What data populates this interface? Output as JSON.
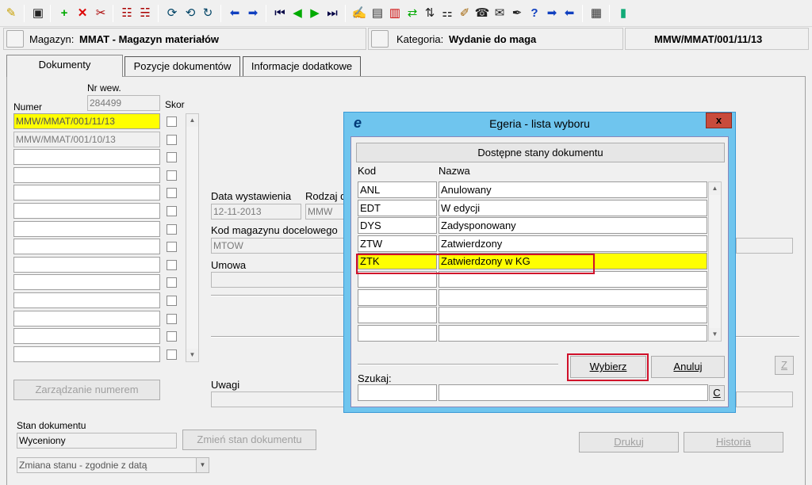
{
  "toolbar": {
    "icons": [
      "pin-icon",
      "save-icon",
      "add-icon",
      "delete-icon",
      "cut-icon",
      "split-icon",
      "split2-icon",
      "refresh-icon",
      "refresh2-icon",
      "refresh3-icon",
      "arrow-left-icon",
      "arrow-right-icon",
      "first-icon",
      "prev-icon",
      "next-icon",
      "last-icon",
      "edit-icon",
      "doc-icon",
      "doc-red-icon",
      "sync-icon",
      "sort-icon",
      "tree-icon",
      "brush-icon",
      "phone-icon",
      "mail-icon",
      "pen-icon",
      "help-icon",
      "forward-icon",
      "back-icon",
      "page-icon",
      "exit-icon"
    ]
  },
  "header": {
    "magazyn_label": "Magazyn:",
    "magazyn_value": "MMAT - Magazyn materiałów",
    "kategoria_label": "Kategoria:",
    "kategoria_value": "Wydanie do maga",
    "doc_number": "MMW/MMAT/001/11/13"
  },
  "tabs": [
    {
      "label": "Dokumenty"
    },
    {
      "label": "Pozycje dokumentów"
    },
    {
      "label": "Informacje dodatkowe"
    }
  ],
  "left": {
    "nr_wew_label": "Nr wew.",
    "nr_wew_value": "284499",
    "numer_label": "Numer",
    "skor_label": "Skor",
    "rows": [
      "MMW/MMAT/001/11/13",
      "MMW/MMAT/001/10/13",
      "",
      "",
      "",
      "",
      "",
      "",
      "",
      "",
      "",
      "",
      "",
      ""
    ]
  },
  "mid": {
    "data_wyst_label": "Data wystawienia",
    "data_wyst_value": "12-11-2013",
    "rodzaj_label": "Rodzaj d",
    "rodzaj_value": "MMW",
    "kod_mag_label": "Kod magazynu docelowego",
    "kod_mag_value": "MTOW",
    "umowa_label": "Umowa",
    "umowa_value": "",
    "uwagi_label": "Uwagi",
    "uwagi_value": ""
  },
  "buttons": {
    "zarzadzanie": "Zarządzanie numerem",
    "zmien_stan": "Zmień stan dokumentu",
    "drukuj": "Drukuj",
    "historia": "Historia",
    "z_btn": "Z"
  },
  "bottom": {
    "stan_label": "Stan dokumentu",
    "stan_value": "Wyceniony",
    "zmiana_value": "Zmiana stanu - zgodnie z datą"
  },
  "dialog": {
    "title": "Egeria - lista wyboru",
    "logo": "e",
    "close": "x",
    "header_button": "Dostępne stany dokumentu",
    "col_kod": "Kod",
    "col_nazwa": "Nazwa",
    "rows": [
      {
        "kod": "ANL",
        "nazwa": "Anulowany"
      },
      {
        "kod": "EDT",
        "nazwa": "W edycji"
      },
      {
        "kod": "DYS",
        "nazwa": "Zadysponowany"
      },
      {
        "kod": "ZTW",
        "nazwa": "Zatwierdzony"
      },
      {
        "kod": "ZTK",
        "nazwa": "Zatwierdzony w KG"
      },
      {
        "kod": "",
        "nazwa": ""
      },
      {
        "kod": "",
        "nazwa": ""
      },
      {
        "kod": "",
        "nazwa": ""
      },
      {
        "kod": "",
        "nazwa": ""
      }
    ],
    "selected_index": 4,
    "wybierz": "Wybierz",
    "anuluj": "Anuluj",
    "szukaj_label": "Szukaj:",
    "szukaj_kod": "",
    "szukaj_nazwa": "",
    "c_button": "C"
  },
  "colors": {
    "highlight": "#ffff00",
    "dialog_frame": "#6fc5ee",
    "red_annotation": "#d0102a"
  }
}
